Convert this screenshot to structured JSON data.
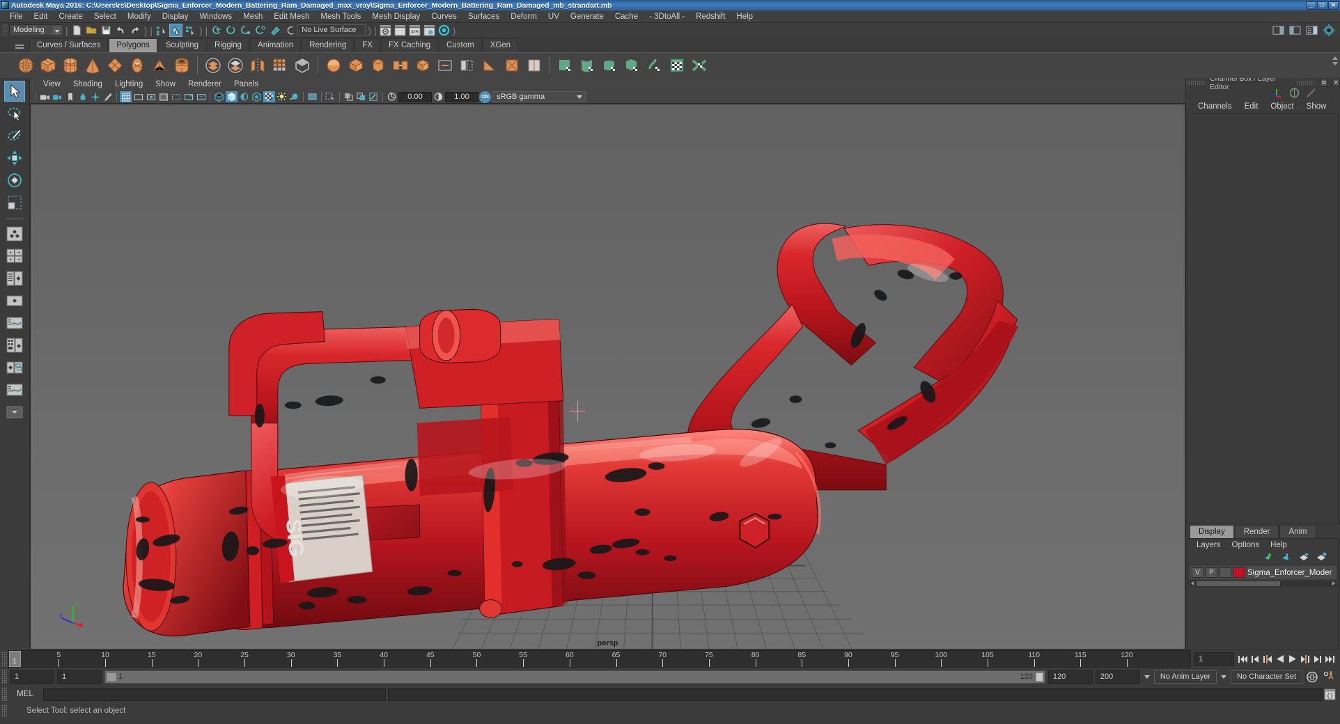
{
  "window": {
    "title": "Autodesk Maya 2016: C:\\Users\\rs\\Desktop\\Sigma_Enforcer_Modern_Battering_Ram_Damaged_max_vray\\Sigma_Enforcer_Modern_Battering_Ram_Damaged_mb_strandart.mb",
    "minimize": "_",
    "maximize": "□",
    "close": "✕",
    "accent_blue": "#3f7bbd"
  },
  "menubar": {
    "items": [
      "File",
      "Edit",
      "Create",
      "Select",
      "Modify",
      "Display",
      "Windows",
      "Mesh",
      "Edit Mesh",
      "Mesh Tools",
      "Mesh Display",
      "Curves",
      "Surfaces",
      "Deform",
      "UV",
      "Generate",
      "Cache",
      "- 3DtoAll -",
      "Redshift",
      "Help"
    ]
  },
  "statusbar": {
    "menuset": "Modeling",
    "live_surface": "No Live Surface"
  },
  "shelf": {
    "tabs": [
      "Curves / Surfaces",
      "Polygons",
      "Sculpting",
      "Rigging",
      "Animation",
      "Rendering",
      "FX",
      "FX Caching",
      "Custom",
      "XGen"
    ],
    "active_tab": "Polygons",
    "primitive_color": "#e09256",
    "tool_color": "#b8b8b8",
    "uv_color": "#5fa885"
  },
  "toolbox": {
    "items": [
      {
        "name": "select-tool",
        "active": true
      },
      {
        "name": "lasso-select-tool",
        "active": false
      },
      {
        "name": "paint-select-tool",
        "active": false
      },
      {
        "name": "move-tool",
        "active": false
      },
      {
        "name": "rotate-tool",
        "active": false
      },
      {
        "name": "scale-tool",
        "active": false
      }
    ],
    "layout_presets": [
      "single-perspective",
      "four-view",
      "two-pane-side",
      "outliner-persp",
      "hypergraph-persp",
      "graph-editor",
      "persp-graph"
    ]
  },
  "viewport": {
    "panel_menus": [
      "View",
      "Shading",
      "Lighting",
      "Show",
      "Renderer",
      "Panels"
    ],
    "exposure": "0.00",
    "gamma": "1.00",
    "color_space": "sRGB gamma",
    "color_mgmt_toggle": "ON",
    "camera_label": "persp",
    "axis": {
      "x": "x",
      "y": "y",
      "z": "z"
    },
    "model_color": "#cc1f22",
    "grid_color": "#555555",
    "bg_top": "#636363",
    "bg_bottom": "#6f6f6f"
  },
  "channelbox": {
    "panel_title": "Channel Box / Layer Editor",
    "menus": [
      "Channels",
      "Edit",
      "Object",
      "Show"
    ],
    "float_btn": "⧉",
    "close_btn": "✕"
  },
  "layereditor": {
    "tabs": [
      "Display",
      "Render",
      "Anim"
    ],
    "active_tab": "Display",
    "menus": [
      "Layers",
      "Options",
      "Help"
    ],
    "columns": [
      "V",
      "P"
    ],
    "layers": [
      {
        "visible": "V",
        "playback": "P",
        "type": "",
        "color": "#c2102b",
        "name": "Sigma_Enforcer_Moder"
      }
    ]
  },
  "timeslider": {
    "ticks": [
      5,
      10,
      15,
      20,
      25,
      30,
      35,
      40,
      45,
      50,
      55,
      60,
      65,
      70,
      75,
      80,
      85,
      90,
      95,
      100,
      105,
      110,
      115,
      120
    ],
    "current_frame": "1",
    "playhead_label": "1",
    "start": 1,
    "end": 120
  },
  "rangeslider": {
    "anim_start": "1",
    "range_start": "1",
    "range_bar_left_label": "1",
    "range_bar_right_label": "120",
    "range_end": "120",
    "anim_end": "200",
    "anim_layer": "No Anim Layer",
    "character_set": "No Character Set"
  },
  "commandline": {
    "language": "MEL",
    "command_value": "",
    "output_value": ""
  },
  "helpline": {
    "text": "Select Tool: select an object"
  }
}
